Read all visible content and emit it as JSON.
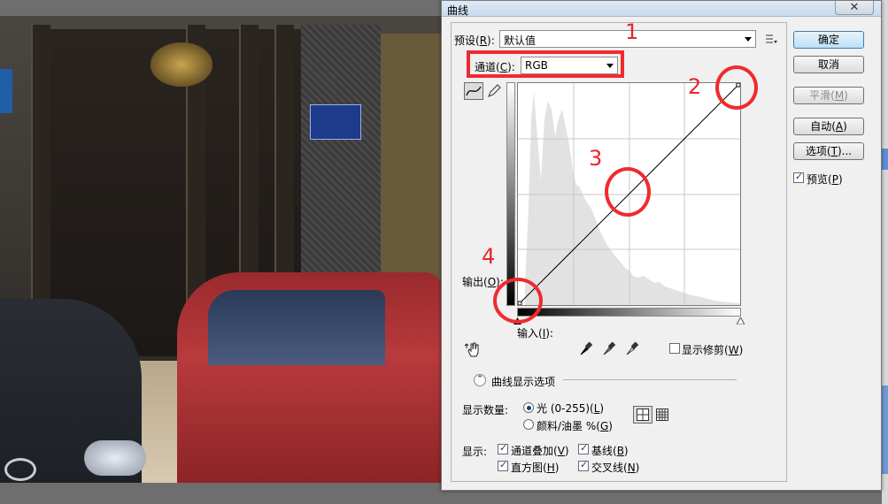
{
  "dialog": {
    "title": "曲线",
    "close_label": "✕",
    "preset": {
      "label_pre": "预设(",
      "label_key": "R",
      "label_post": "):",
      "value": "默认值"
    },
    "channel": {
      "label_pre": "通道(",
      "label_key": "C",
      "label_post": "):",
      "value": "RGB"
    },
    "output_label_pre": "输出(",
    "output_label_key": "O",
    "output_label_post": "):",
    "input_label_pre": "输入(",
    "input_label_key": "I",
    "input_label_post": "):",
    "show_clipping": {
      "label_pre": "显示修剪(",
      "label_key": "W",
      "label_post": ")",
      "checked": false
    },
    "curve_display_options": "曲线显示选项",
    "show_amount": {
      "label": "显示数量:",
      "light": {
        "label_pre": "光 (0-255)(",
        "label_key": "L",
        "label_post": ")",
        "selected": true
      },
      "pigment": {
        "label_pre": "颜料/油墨 %(",
        "label_key": "G",
        "label_post": ")",
        "selected": false
      }
    },
    "show": {
      "label": "显示:",
      "channel_overlays": {
        "label_pre": "通道叠加(",
        "label_key": "V",
        "label_post": ")",
        "checked": true
      },
      "baseline": {
        "label_pre": "基线(",
        "label_key": "B",
        "label_post": ")",
        "checked": true
      },
      "histogram": {
        "label_pre": "直方图(",
        "label_key": "H",
        "label_post": ")",
        "checked": true
      },
      "intersection": {
        "label_pre": "交叉线(",
        "label_key": "N",
        "label_post": ")",
        "checked": true
      }
    },
    "buttons": {
      "ok": "确定",
      "cancel": "取消",
      "smooth": {
        "pre": "平滑(",
        "key": "M",
        "post": ")"
      },
      "auto": {
        "pre": "自动(",
        "key": "A",
        "post": ")"
      },
      "options": {
        "pre": "选项(",
        "key": "T",
        "post": ")..."
      }
    },
    "preview": {
      "label_pre": "预览(",
      "label_key": "P",
      "label_post": ")",
      "checked": true
    },
    "curve": {
      "points": [
        [
          0,
          0
        ],
        [
          255,
          255
        ]
      ]
    },
    "histogram_tool_icons": [
      "curve-tool-icon",
      "pencil-tool-icon",
      "hand-adjust-icon",
      "black-eyedropper-icon",
      "gray-eyedropper-icon",
      "white-eyedropper-icon",
      "grid-4-icon",
      "grid-10-icon"
    ]
  },
  "annotations": [
    "1",
    "2",
    "3",
    "4"
  ],
  "colors": {
    "annotation_red": "#ef2b2f",
    "ok_button": "#bfe0f4"
  }
}
